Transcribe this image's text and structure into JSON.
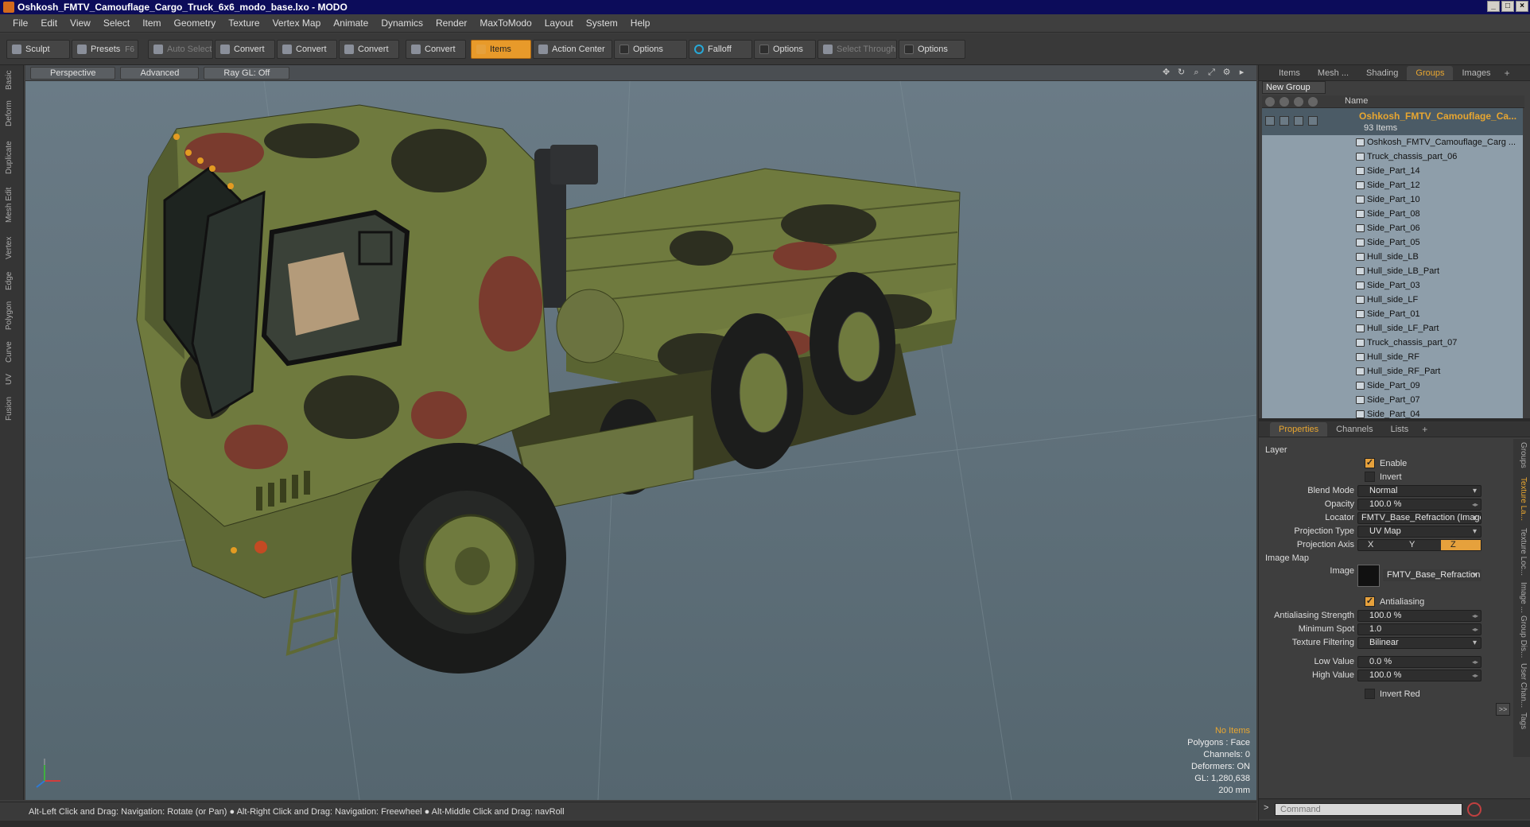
{
  "window": {
    "title": "Oshkosh_FMTV_Camouflage_Cargo_Truck_6x6_modo_base.lxo - MODO"
  },
  "menu": [
    "File",
    "Edit",
    "View",
    "Select",
    "Item",
    "Geometry",
    "Texture",
    "Vertex Map",
    "Animate",
    "Dynamics",
    "Render",
    "MaxToModo",
    "Layout",
    "System",
    "Help"
  ],
  "toolbar": {
    "sculpt": "Sculpt",
    "presets": "Presets",
    "presets_key": "F6",
    "auto_select": "Auto Select",
    "convert": "Convert",
    "items": "Items",
    "action_center": "Action Center",
    "options": "Options",
    "falloff": "Falloff",
    "select_through": "Select Through"
  },
  "left_tabs": [
    "Basic",
    "Deform",
    "Duplicate",
    "Mesh Edit",
    "Vertex",
    "Edge",
    "Polygon",
    "Curve",
    "UV",
    "Fusion"
  ],
  "viewport": {
    "view": "Perspective",
    "mode": "Advanced",
    "raygl": "Ray GL: Off",
    "info": {
      "items": "No Items",
      "polygons": "Polygons : Face",
      "channels": "Channels: 0",
      "deformers": "Deformers: ON",
      "gl": "GL: 1,280,638",
      "scale": "200 mm"
    }
  },
  "status": "Alt-Left Click and Drag: Navigation: Rotate (or Pan) ● Alt-Right Click and Drag: Navigation: Freewheel ● Alt-Middle Click and Drag: navRoll",
  "panel_tabs": [
    "Items",
    "Mesh ...",
    "Shading",
    "Groups",
    "Images"
  ],
  "groups": {
    "new_group": "New Group",
    "col_name": "Name",
    "group_name": "Oshkosh_FMTV_Camouflage_Ca...",
    "count": "93 Items",
    "items": [
      "Oshkosh_FMTV_Camouflage_Carg ...",
      "Truck_chassis_part_06",
      "Side_Part_14",
      "Side_Part_12",
      "Side_Part_10",
      "Side_Part_08",
      "Side_Part_06",
      "Side_Part_05",
      "Hull_side_LB",
      "Hull_side_LB_Part",
      "Side_Part_03",
      "Hull_side_LF",
      "Side_Part_01",
      "Hull_side_LF_Part",
      "Truck_chassis_part_07",
      "Hull_side_RF",
      "Hull_side_RF_Part",
      "Side_Part_09",
      "Side_Part_07",
      "Side_Part_04"
    ]
  },
  "prop_tabs": [
    "Properties",
    "Channels",
    "Lists"
  ],
  "properties": {
    "layer": "Layer",
    "enable": "Enable",
    "invert": "Invert",
    "blend_mode_label": "Blend Mode",
    "blend_mode": "Normal",
    "opacity_label": "Opacity",
    "opacity": "100.0 %",
    "locator_label": "Locator",
    "locator": "FMTV_Base_Refraction (Image) (...",
    "proj_type_label": "Projection Type",
    "proj_type": "UV Map",
    "proj_axis_label": "Projection Axis",
    "axis_x": "X",
    "axis_y": "Y",
    "axis_z": "Z",
    "image_map": "Image Map",
    "image_label": "Image",
    "image": "FMTV_Base_Refraction",
    "antialiasing": "Antialiasing",
    "aa_strength_label": "Antialiasing Strength",
    "aa_strength": "100.0 %",
    "min_spot_label": "Minimum Spot",
    "min_spot": "1.0",
    "tex_filter_label": "Texture Filtering",
    "tex_filter": "Bilinear",
    "low_label": "Low Value",
    "low": "0.0 %",
    "high_label": "High Value",
    "high": "100.0 %",
    "invert_red": "Invert Red",
    "more": ">>"
  },
  "right_vtabs": [
    "Groups",
    "Texture La...",
    "Texture Loc...",
    "Image ...",
    "Group Dis...",
    "User Chan...",
    "Tags"
  ],
  "command": {
    "placeholder": "Command"
  }
}
